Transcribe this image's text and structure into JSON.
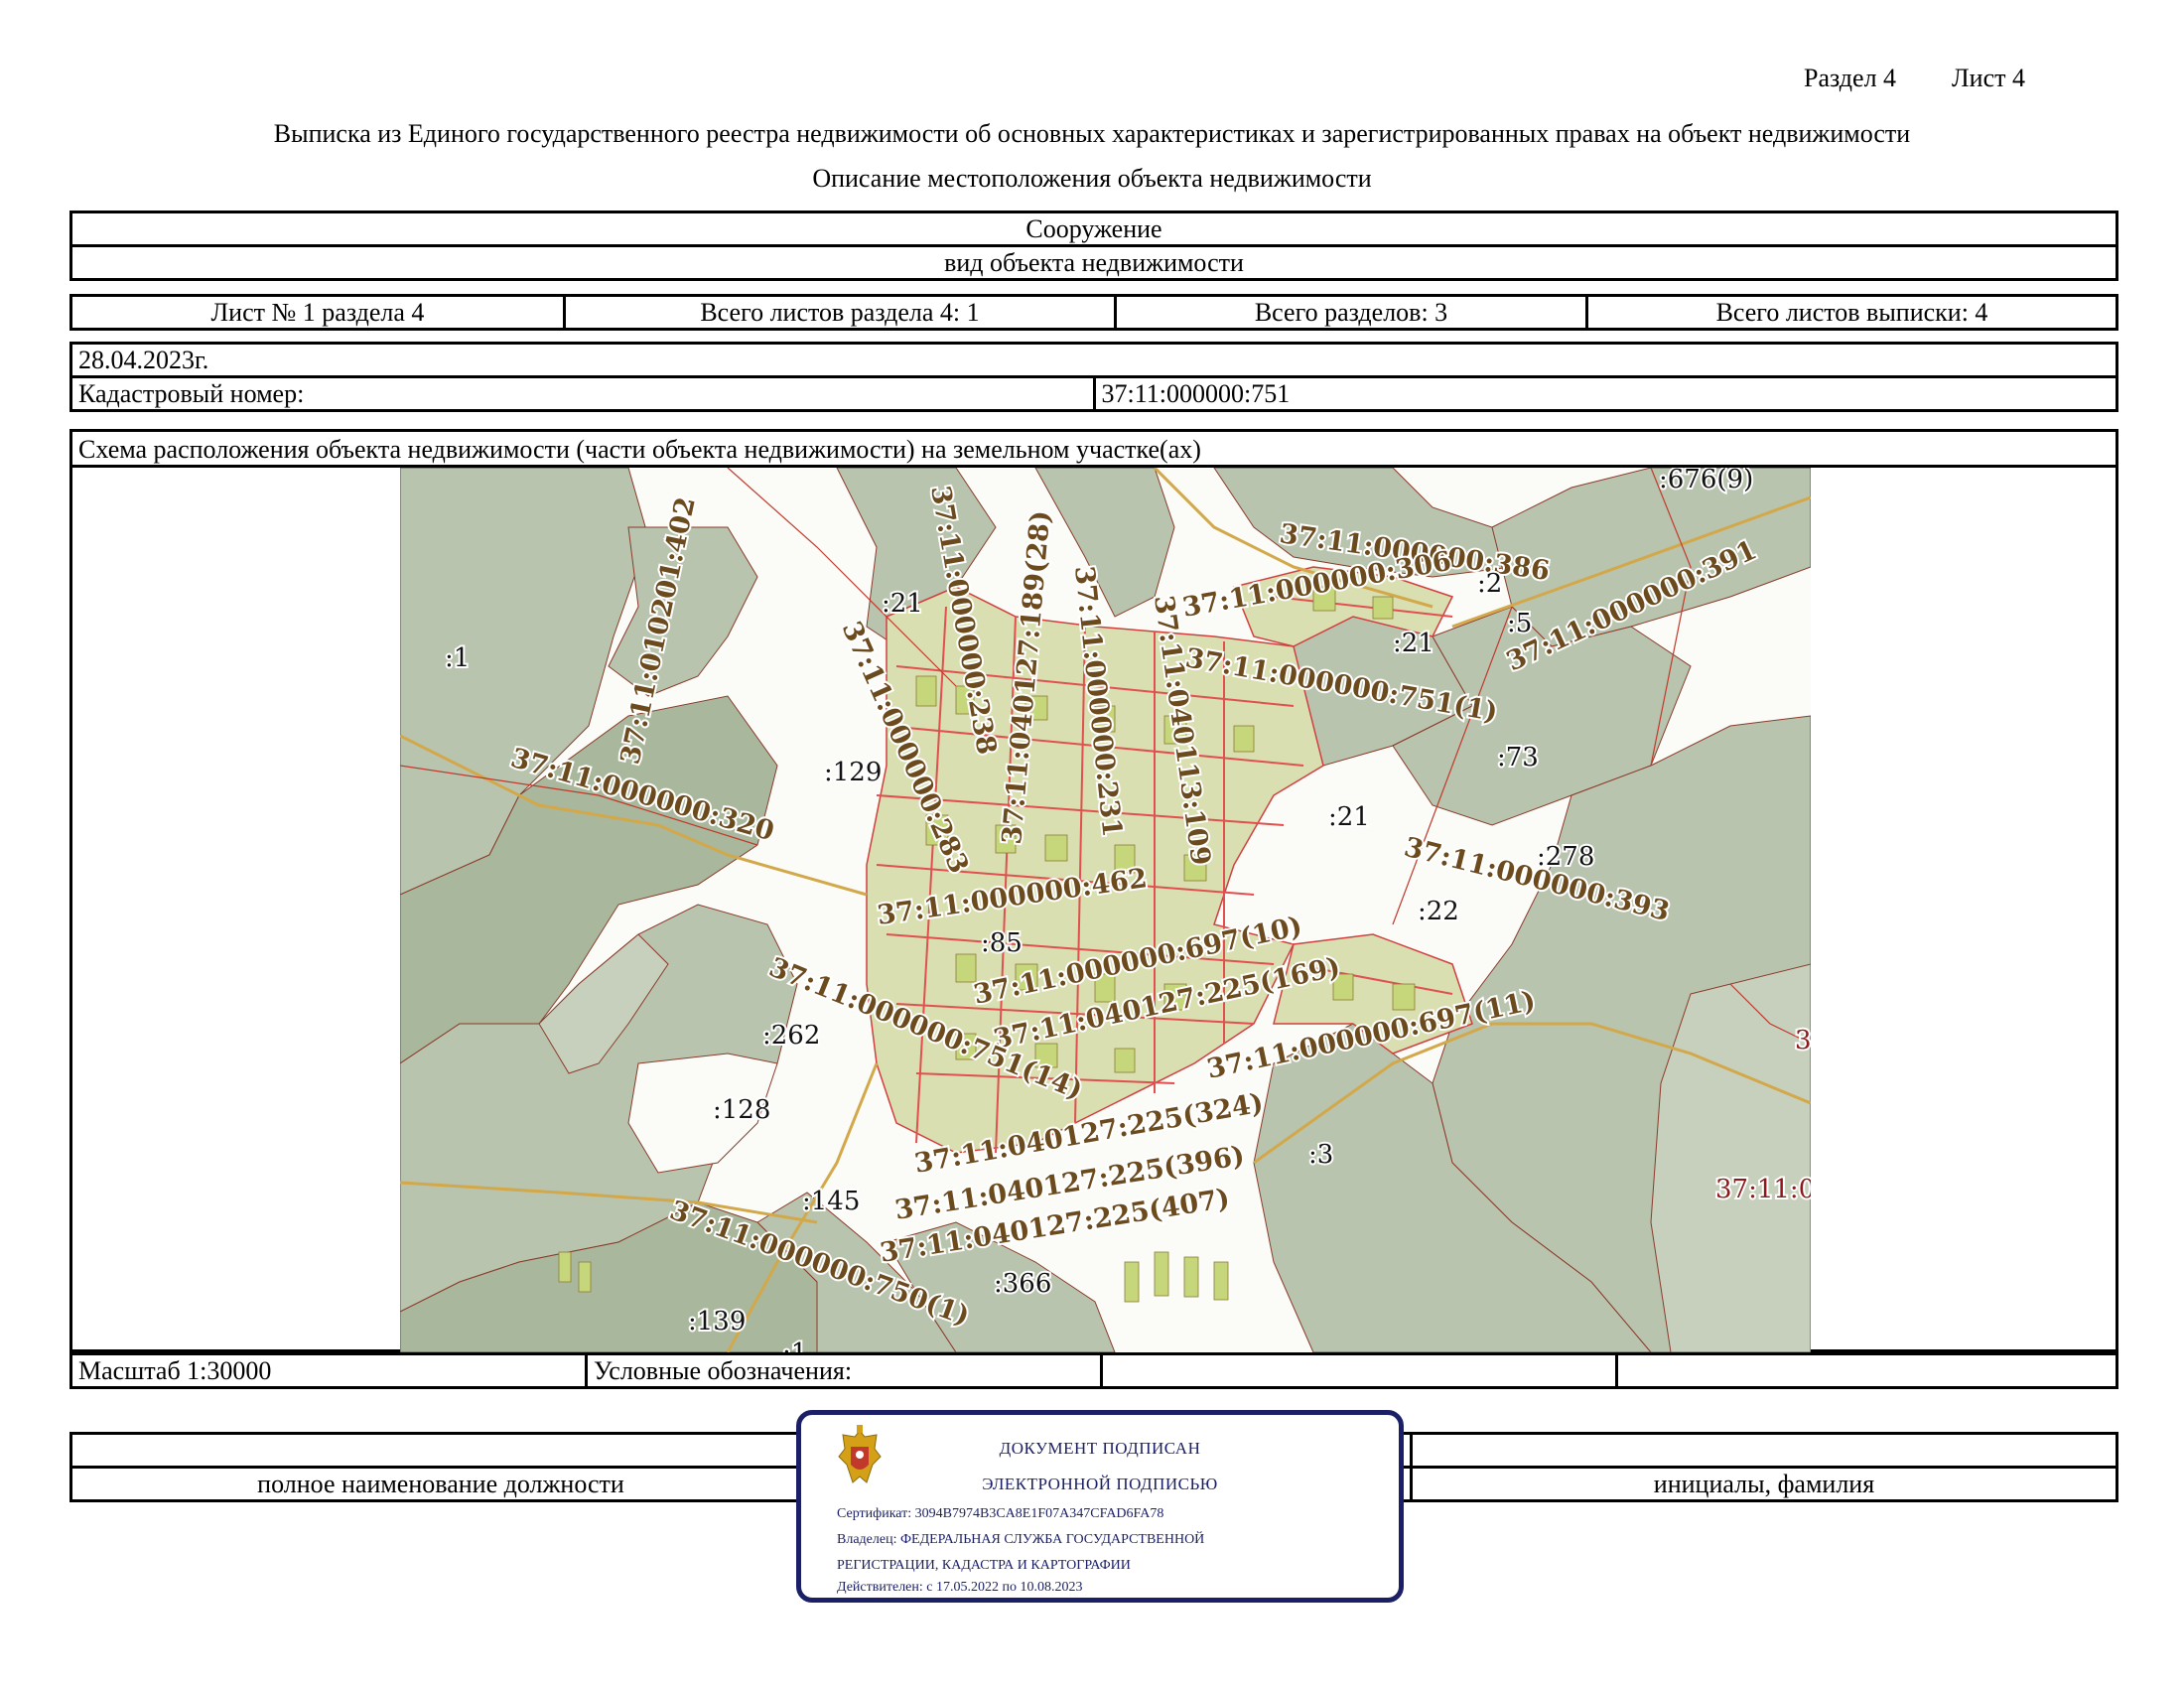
{
  "header": {
    "section": "Раздел 4",
    "sheet": "Лист 4"
  },
  "title": "Выписка из Единого государственного реестра недвижимости об основных характеристиках и зарегистрированных правах на объект недвижимости",
  "subtitle": "Описание местоположения объекта недвижимости",
  "object": {
    "type": "Сооружение",
    "type_caption": "вид объекта недвижимости"
  },
  "sheets": {
    "sheet_no": "Лист № 1 раздела 4",
    "total_section_sheets": "Всего листов раздела 4: 1",
    "total_sections": "Всего разделов: 3",
    "total_extract_sheets": "Всего листов выписки: 4"
  },
  "date": "28.04.2023г.",
  "cadastral": {
    "label": "Кадастровый номер:",
    "value": "37:11:000000:751"
  },
  "scheme_title": "Схема расположения объекта недвижимости (части объекта недвижимости) на земельном участке(ах)",
  "map_labels": {
    "main": [
      "37:11:000000:386",
      "37:11:000000:306",
      "37:11:000000:391",
      "37:11:000000:751(1)",
      "37:11:010201:402",
      "37:11:000000:320",
      "37:11:000000:238",
      "37:11:040127:189(28)",
      "37:11:000000:231",
      "37:11:040113:109",
      "37:11:000000:283",
      "37:11:000000:462",
      "37:11:000000:697(10)",
      "37:11:040127:225(169)",
      "37:11:000000:393",
      "37:11:000000:697(11)",
      "37:11:000000:751(14)",
      "37:11:040127:225(324)",
      "37:11:040127:225(396)",
      "37:11:040127:225(407)",
      "37:11:000000:750(1)"
    ],
    "short": [
      ":676(9)",
      ":2",
      ":5",
      ":21",
      ":21",
      ":1",
      ":129",
      ":21",
      ":73",
      ":278",
      ":22",
      ":85",
      ":262",
      ":128",
      ":3",
      ":145",
      ":366",
      ":139",
      ":1"
    ],
    "red": [
      "3",
      "37:11:0"
    ]
  },
  "footer_row": {
    "scale": "Масштаб 1:30000",
    "legend": "Условные обозначения:"
  },
  "signature": {
    "position_caption": "полное наименование должности",
    "name_caption": "инициалы, фамилия"
  },
  "stamp": {
    "line1": "ДОКУМЕНТ ПОДПИСАН",
    "line2": "ЭЛЕКТРОННОЙ ПОДПИСЬЮ",
    "certificate": "Сертификат: 3094B7974B3CA8E1F07A347CFAD6FA78",
    "owner1": "Владелец: ФЕДЕРАЛЬНАЯ СЛУЖБА ГОСУДАРСТВЕННОЙ",
    "owner2": "РЕГИСТРАЦИИ, КАДАСТРА И КАРТОГРАФИИ",
    "valid": "Действителен: с 17.05.2022 по 10.08.2023"
  },
  "colors": {
    "field": "#b9c4ae",
    "road": "#e05050",
    "plot": "#c6d67a",
    "label": "#6b4a1e",
    "stamp": "#1a1f66"
  }
}
